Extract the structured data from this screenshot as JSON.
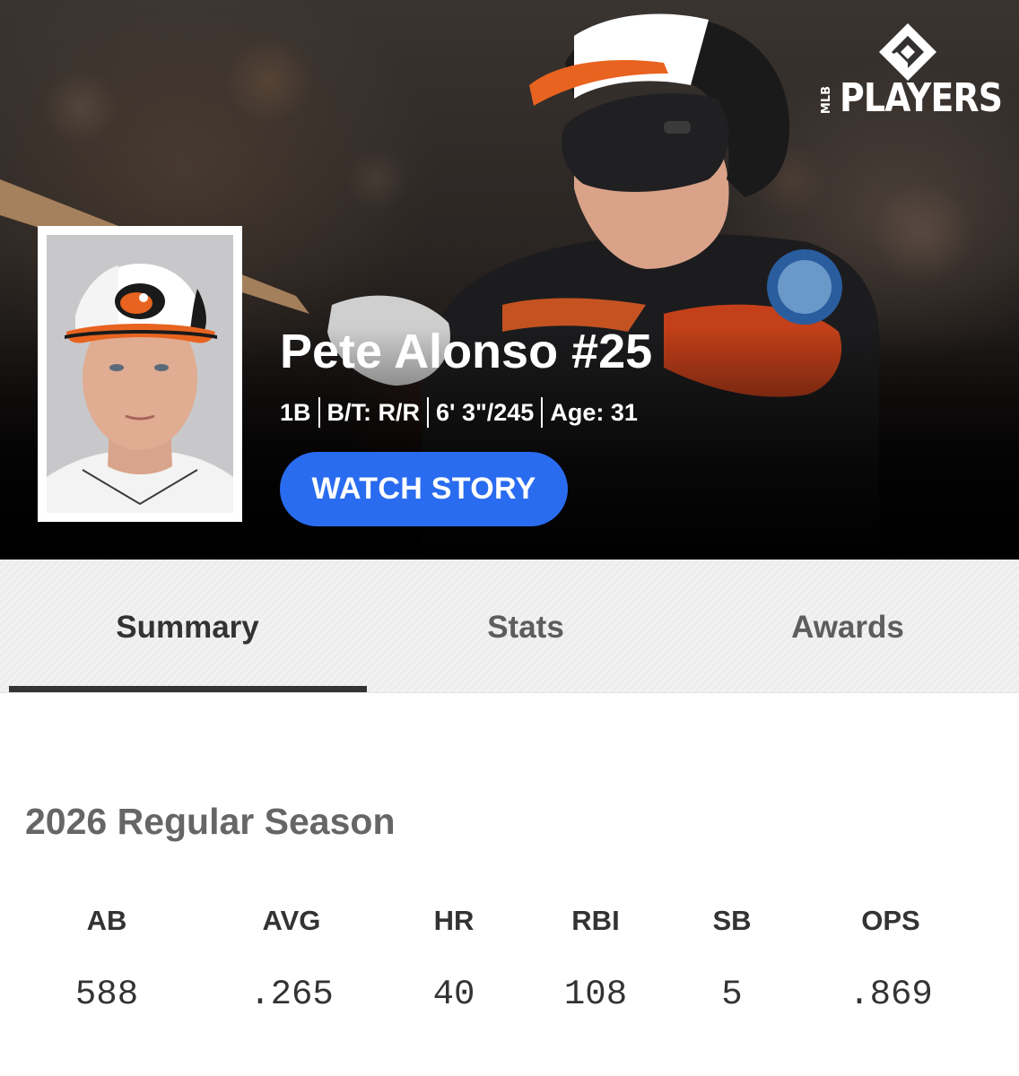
{
  "brand": {
    "logo_text": "PLAYERS",
    "logo_small": "MLB"
  },
  "player": {
    "name": "Pete Alonso #25",
    "position": "1B",
    "bats_throws": "B/T: R/R",
    "height_weight": "6' 3\"/245",
    "age": "Age: 31"
  },
  "hero": {
    "cta_label": "WATCH STORY",
    "accent": "#2a6cf0"
  },
  "tabs": [
    {
      "label": "Summary",
      "active": true
    },
    {
      "label": "Stats",
      "active": false
    },
    {
      "label": "Awards",
      "active": false
    }
  ],
  "season": {
    "title": "2026 Regular Season",
    "stats": [
      {
        "label": "AB",
        "value": "588"
      },
      {
        "label": "AVG",
        "value": ".265"
      },
      {
        "label": "HR",
        "value": "40"
      },
      {
        "label": "RBI",
        "value": "108"
      },
      {
        "label": "SB",
        "value": "5"
      },
      {
        "label": "OPS",
        "value": ".869"
      }
    ]
  },
  "icons": [
    "mlb-players-logo-icon",
    "player-headshot-image",
    "player-action-photo"
  ],
  "colors": {
    "orioles_orange": "#f05a1e",
    "orioles_black": "#1a1a1a"
  }
}
